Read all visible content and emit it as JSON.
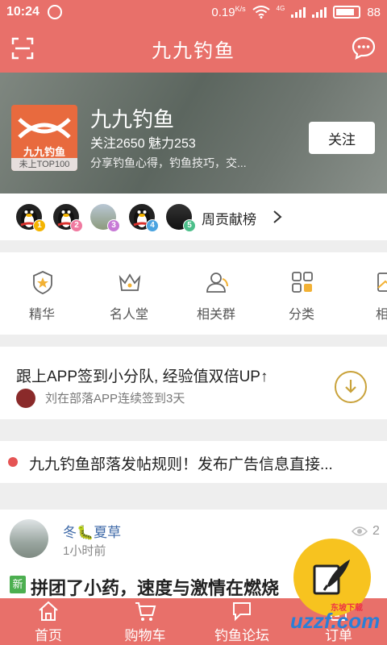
{
  "status_bar": {
    "time": "10:24",
    "speed": "0.19",
    "speed_unit": "K/s",
    "network": "4G",
    "battery": "88"
  },
  "header": {
    "title": "九九钓鱼"
  },
  "tribe": {
    "logo_text": "九九钓鱼",
    "rank": "未上TOP100",
    "name": "九九钓鱼",
    "stats": "关注2650 魅力253",
    "description": "分享钓鱼心得，钓鱼技巧，交...",
    "follow_label": "关注"
  },
  "contributors": {
    "badges": [
      "1",
      "2",
      "3",
      "4",
      "5"
    ],
    "label": "周贡献榜"
  },
  "categories": [
    {
      "label": "精华",
      "icon": "star-badge-icon"
    },
    {
      "label": "名人堂",
      "icon": "crown-icon"
    },
    {
      "label": "相关群",
      "icon": "group-icon"
    },
    {
      "label": "分类",
      "icon": "grid-icon"
    },
    {
      "label": "相",
      "icon": "image-icon"
    }
  ],
  "signin": {
    "title": "跟上APP签到小分队, 经验值双倍UP↑",
    "subtitle": "刘在部落APP连续签到3天"
  },
  "notice": {
    "text": "九九钓鱼部落发帖规则！发布广告信息直接..."
  },
  "post": {
    "username": "冬🐛夏草",
    "time": "1小时前",
    "views": "2",
    "tag": "新",
    "title": "拼团了小药，速度与激情在燃烧"
  },
  "tabbar": {
    "items": [
      "首页",
      "购物车",
      "钓鱼论坛",
      "订单"
    ]
  },
  "watermark": {
    "text": "uzzf.com",
    "small": "东坡下载"
  },
  "colors": {
    "brand": "#e8706a",
    "fab": "#f7c31f",
    "link": "#3f6aa8"
  }
}
